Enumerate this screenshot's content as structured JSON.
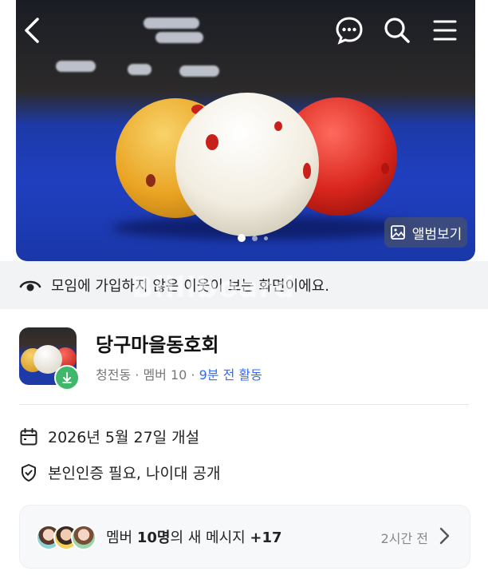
{
  "hero": {
    "album_label": "앨범보기",
    "page_count": 3,
    "current_page": 1
  },
  "notice": {
    "text": "모임에 가입하지 않은 이웃이 보는 화면이에요."
  },
  "watermark": "Billiboard",
  "group": {
    "name": "당구마을동호회",
    "location": "청전동",
    "members": "멤버 10",
    "activity": "9분 전 활동",
    "sep": "·"
  },
  "info": {
    "opened": "2026년 5월 27일 개설",
    "requirement": "본인인증 필요, 나이대 공개"
  },
  "message": {
    "prefix": "멤버 ",
    "count": "10명",
    "middle": "의 새 메시지 ",
    "plus": "+17",
    "time": "2시간 전"
  },
  "colors": {
    "accent": "#2f6bff",
    "badge": "#3fb86b"
  },
  "icons": [
    "back-arrow-icon",
    "chat-bubble-icon",
    "search-icon",
    "menu-icon",
    "image-icon",
    "eye-icon",
    "calendar-icon",
    "shield-check-icon",
    "chevron-right-icon"
  ]
}
